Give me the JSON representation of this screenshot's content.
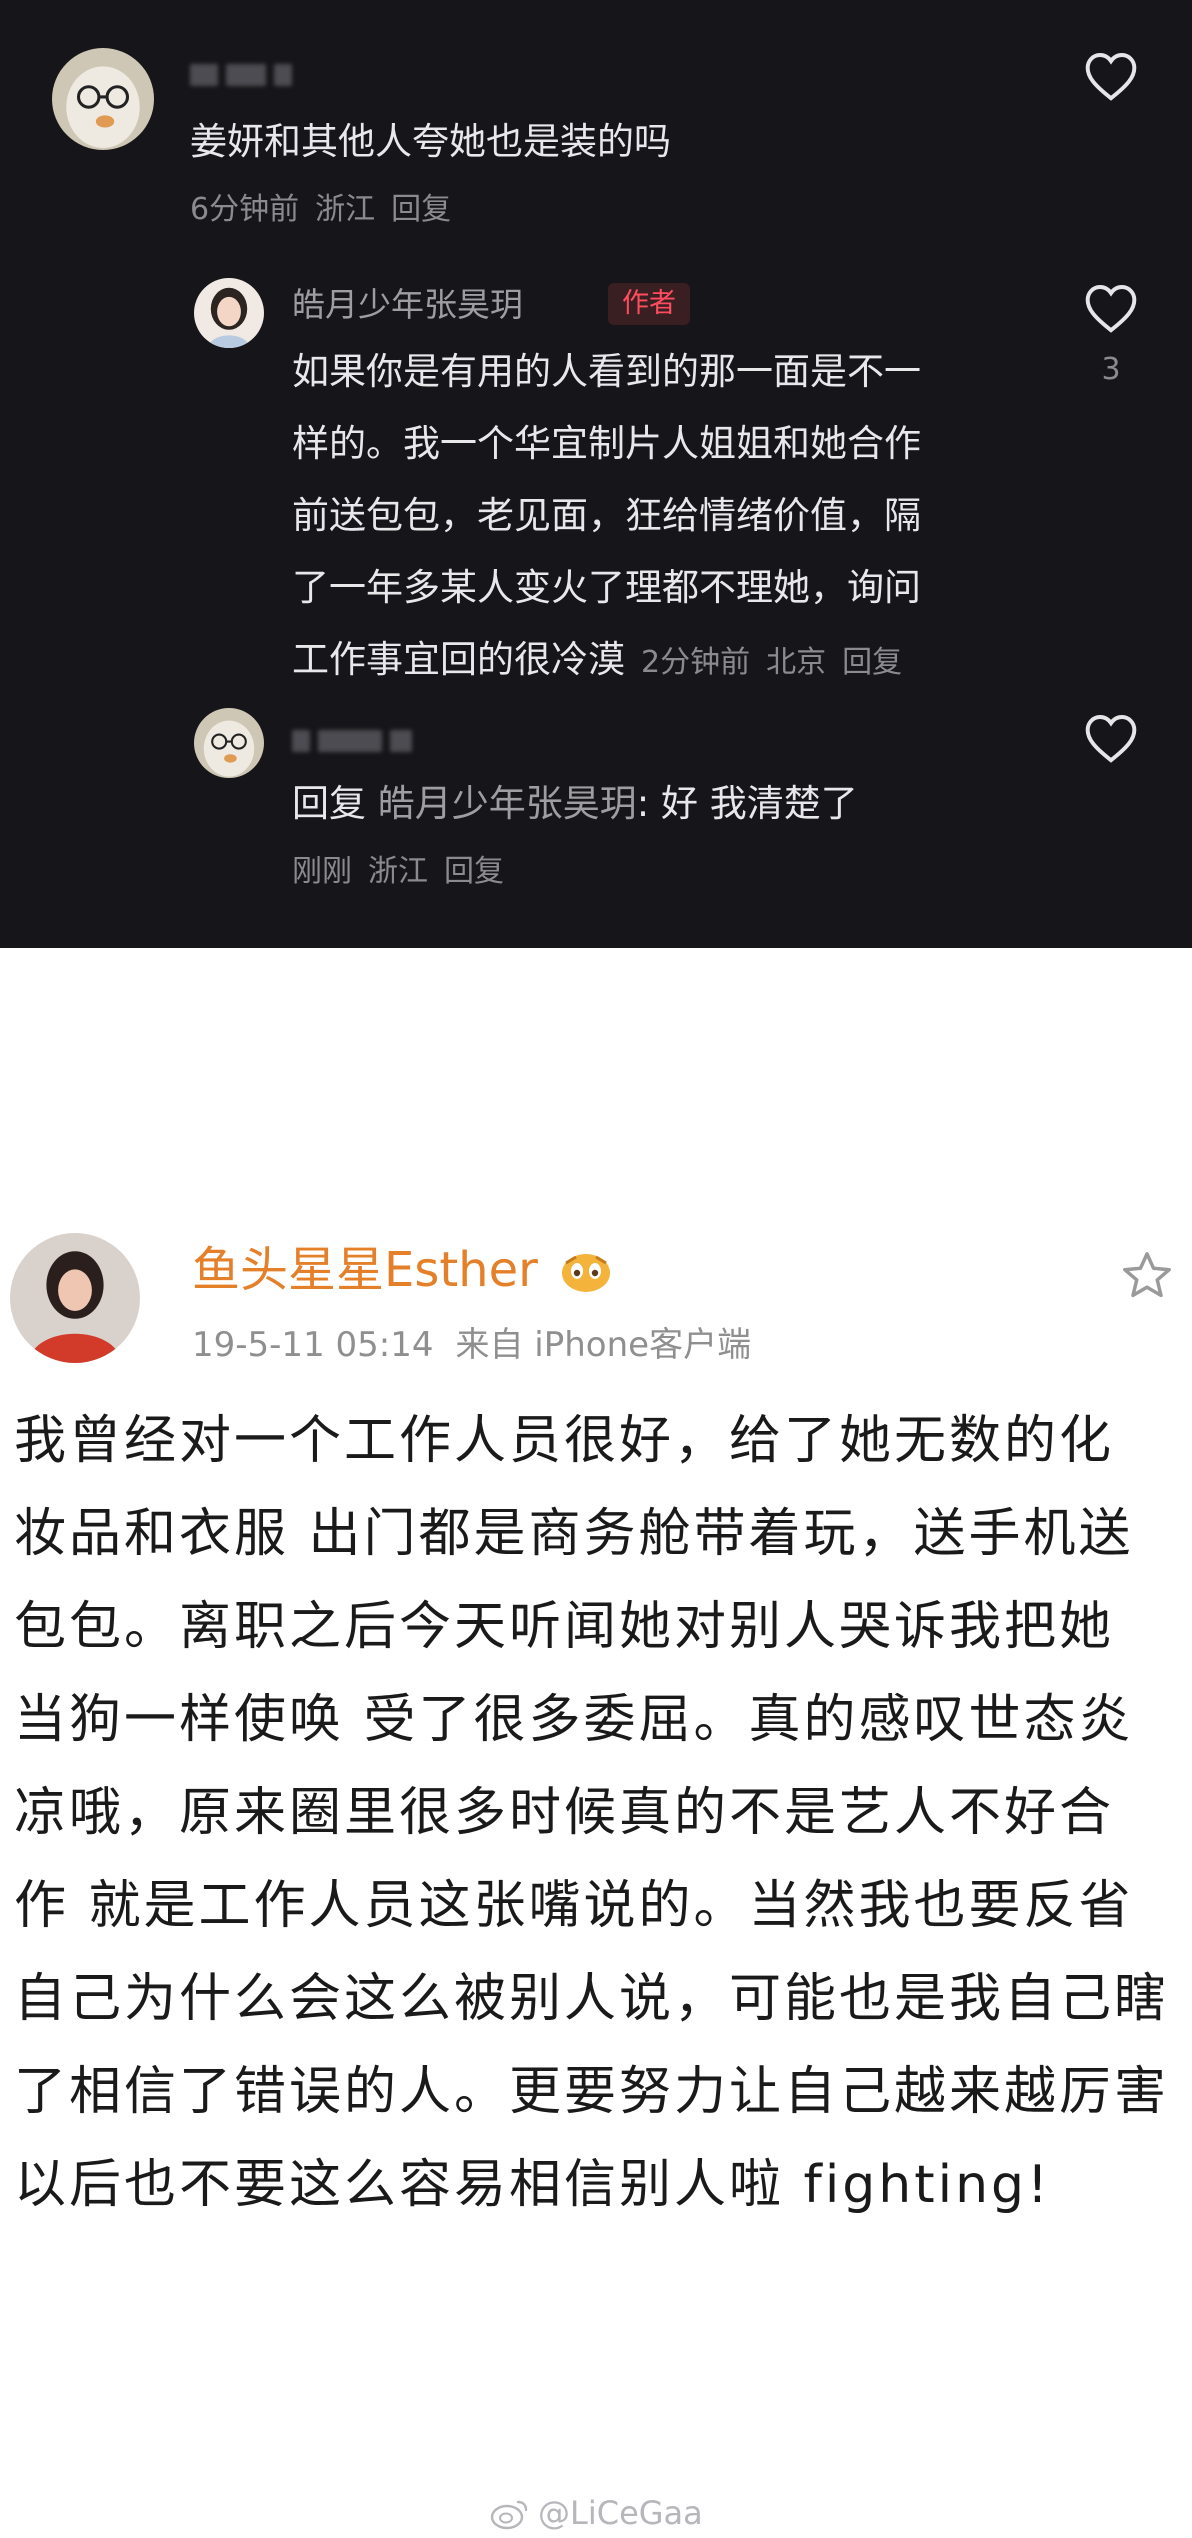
{
  "comments": {
    "first": {
      "text": "姜妍和其他人夸她也是装的吗",
      "time": "6分钟前",
      "location": "浙江",
      "reply": "回复"
    },
    "author_reply": {
      "name": "皓月少年张昊玥",
      "tag": "作者",
      "lines": [
        "如果你是有用的人看到的那一面是不一",
        "样的。我一个华宜制片人姐姐和她合作",
        "前送包包，老见面，狂给情绪价值，隔",
        "了一年多某人变火了理都不理她，询问",
        "工作事宜回的很冷漠"
      ],
      "time": "2分钟前",
      "location": "北京",
      "reply": "回复",
      "likes": "3"
    },
    "follow_up": {
      "prefix": "回复",
      "target": "皓月少年张昊玥",
      "text": ": 好 我清楚了",
      "time": "刚刚",
      "location": "浙江",
      "reply": "回复"
    }
  },
  "post": {
    "username": "鱼头星星Esther",
    "date": "19-5-11 05:14",
    "source": "来自 iPhone客户端",
    "lines": [
      "我曾经对一个工作人员很好，给了她无数的化",
      "妆品和衣服 出门都是商务舱带着玩，送手机送",
      "包包。离职之后今天听闻她对别人哭诉我把她",
      "当狗一样使唤 受了很多委屈。真的感叹世态炎",
      "凉哦，原来圈里很多时候真的不是艺人不好合",
      "作 就是工作人员这张嘴说的。当然我也要反省",
      "自己为什么会这么被别人说，可能也是我自己瞎",
      "了相信了错误的人。更要努力让自己越来越厉害",
      "以后也不要这么容易相信别人啦 fighting!"
    ]
  },
  "watermark": "@LiCeGaa",
  "colors": {
    "dark_bg": "#16161a",
    "username_orange": "#e5802a",
    "author_tag_red": "#ff4d5e"
  },
  "icons": [
    "heart-outline-icon",
    "star-outline-icon",
    "weibo-logo-icon",
    "emoji-badge-icon"
  ]
}
